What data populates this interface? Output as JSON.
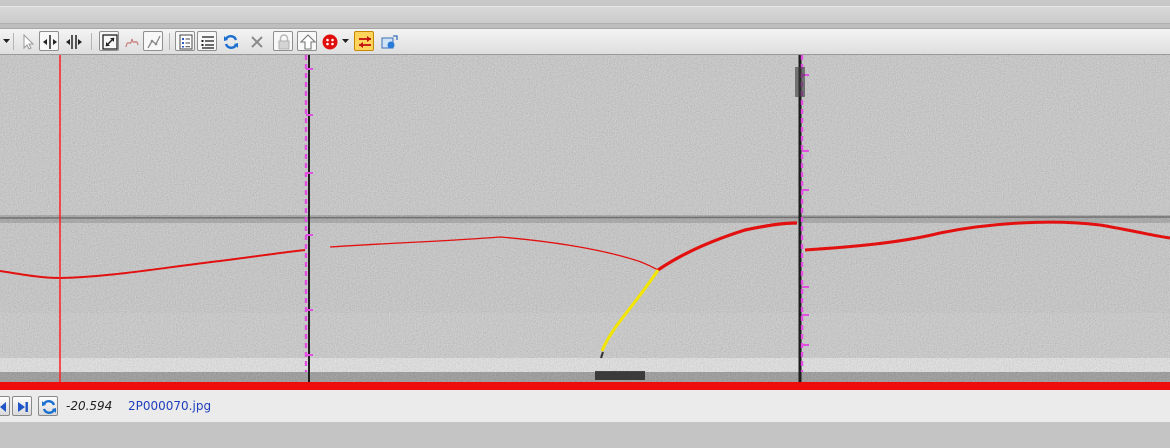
{
  "toolbar": {
    "buttons": [
      {
        "name": "dropdown-arrow-icon"
      },
      {
        "name": "select-pointer-icon"
      },
      {
        "name": "horizontal-measure-icon"
      },
      {
        "name": "column-split-icon"
      },
      {
        "name": "zoom-extent-icon"
      },
      {
        "name": "squiggle-crack-icon"
      },
      {
        "name": "polyline-draw-icon"
      },
      {
        "name": "list-details-icon"
      },
      {
        "name": "list-tree-icon"
      },
      {
        "name": "refresh-icon"
      },
      {
        "name": "delete-x-icon"
      },
      {
        "name": "lock-icon"
      },
      {
        "name": "upload-arrow-icon"
      },
      {
        "name": "record-dots-icon"
      },
      {
        "name": "swap-arrows-icon"
      },
      {
        "name": "export-image-icon"
      }
    ]
  },
  "viewer": {
    "colors": {
      "primary_crack": "#e31010",
      "secondary_crack": "#f2e600",
      "joint_marker": "#e14ee1",
      "cursor_line": "#ff2020",
      "progress_bar": "#ee0c0c"
    }
  },
  "status": {
    "coordinate": "-20.594",
    "filename": "2P000070.jpg"
  }
}
